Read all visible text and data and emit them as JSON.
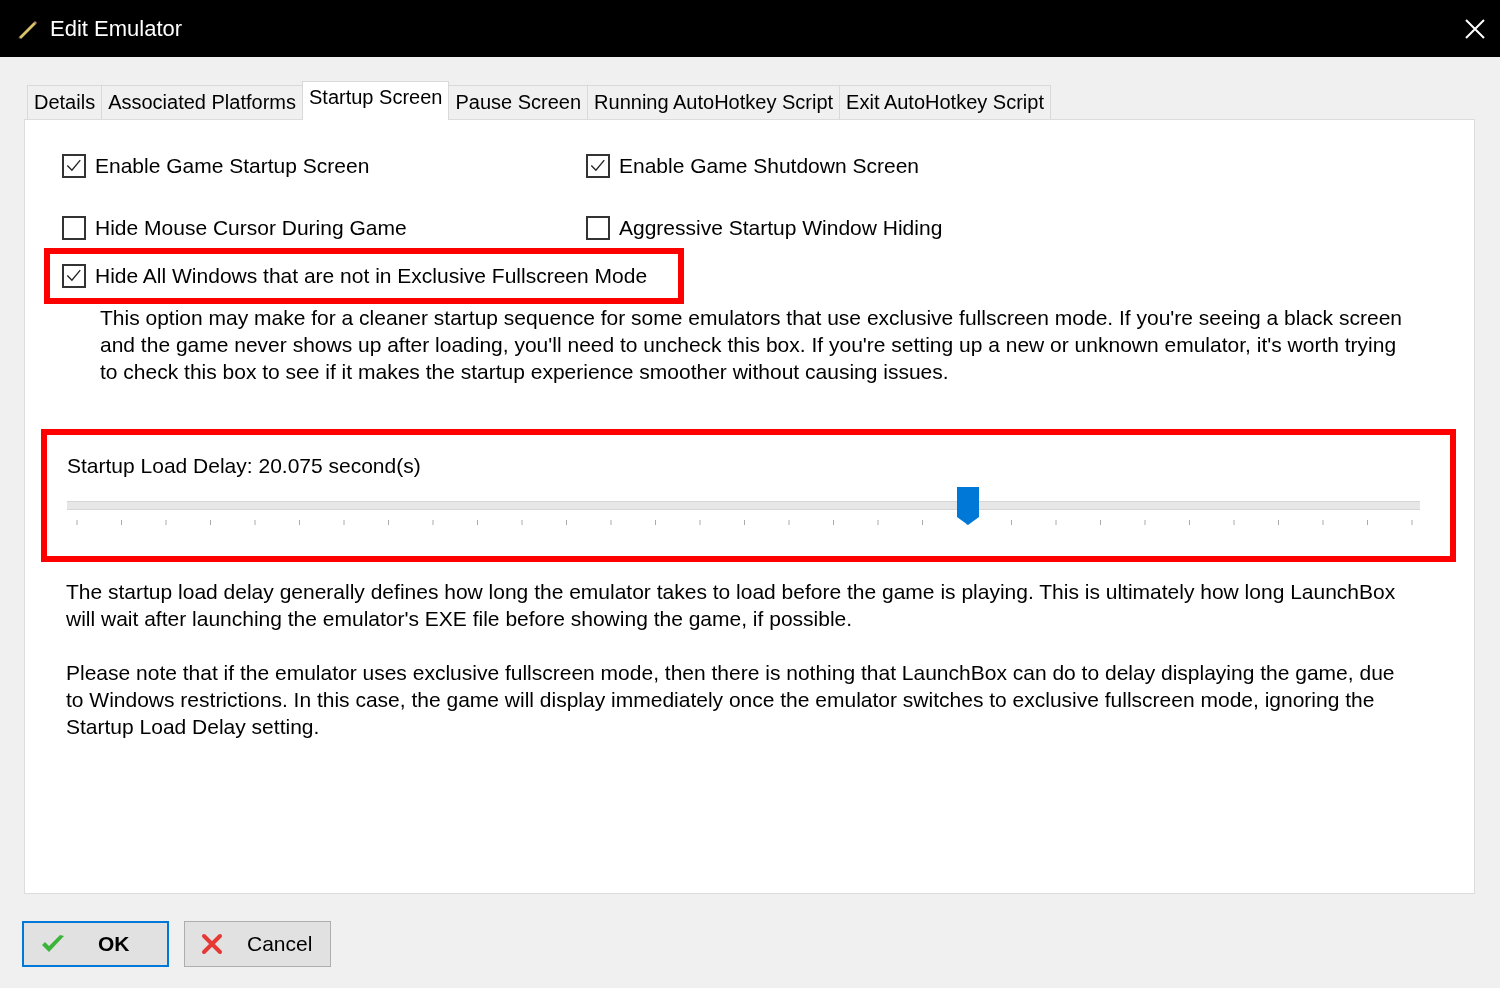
{
  "window": {
    "title": "Edit Emulator"
  },
  "tabs": [
    {
      "label": "Details",
      "selected": false
    },
    {
      "label": "Associated Platforms",
      "selected": false
    },
    {
      "label": "Startup Screen",
      "selected": true
    },
    {
      "label": "Pause Screen",
      "selected": false
    },
    {
      "label": "Running AutoHotkey Script",
      "selected": false
    },
    {
      "label": "Exit AutoHotkey Script",
      "selected": false
    }
  ],
  "options": [
    {
      "label": "Enable Game Startup Screen",
      "checked": true,
      "highlighted": false
    },
    {
      "label": "Enable Game Shutdown Screen",
      "checked": true,
      "highlighted": false
    },
    {
      "label": "Hide Mouse Cursor During Game",
      "checked": false,
      "highlighted": false
    },
    {
      "label": "Aggressive Startup Window Hiding",
      "checked": false,
      "highlighted": false
    },
    {
      "label": "Hide All Windows that are not in Exclusive Fullscreen Mode",
      "checked": true,
      "highlighted": true
    }
  ],
  "option_note": "This option may make for a cleaner startup sequence for some emulators that use exclusive fullscreen mode. If you're seeing a black screen and the game never shows up after loading, you'll need to uncheck this box. If you're setting up a new or unknown emulator, it's worth trying to check this box to see if it makes the startup experience smoother without causing issues.",
  "slider": {
    "label": "Startup Load Delay: 20.075 second(s)",
    "level": 0.666,
    "highlighted": true
  },
  "notes": [
    "The startup load delay generally defines how long the emulator takes to load before the game is playing. This is ultimately how long LaunchBox will wait after launching the emulator's EXE file before showing the game, if possible.",
    "Please note that if the emulator uses exclusive fullscreen mode, then there is nothing that LaunchBox can do to delay displaying the game, due to Windows restrictions. In this case, the game will display immediately once the emulator switches to exclusive fullscreen mode, ignoring the Startup Load Delay setting."
  ],
  "buttons": [
    {
      "label": "OK",
      "kind": "ok",
      "default": true
    },
    {
      "label": "Cancel",
      "kind": "cancel",
      "default": false
    }
  ]
}
